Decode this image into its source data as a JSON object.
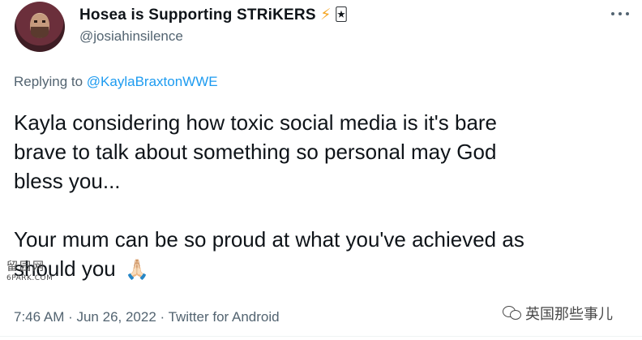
{
  "author": {
    "display_name": "Hosea is Supporting STRiKERS",
    "name_emoji_bolt": "⚡",
    "name_emoji_jester": "🃏",
    "handle": "@josiahinsilence"
  },
  "reply": {
    "prefix": "Replying to ",
    "mention": "@KaylaBraxtonWWE"
  },
  "body": {
    "line1": "Kayla considering how toxic social media is it's bare",
    "line2": "brave to talk about something so personal may God",
    "line3": "bless you...",
    "line4": "Your mum can be so proud at what you've achieved as",
    "line5": "should you",
    "emoji": "🙏🏻"
  },
  "meta": {
    "text": "7:46 AM · Jun 26, 2022 · Twitter for Android"
  },
  "watermarks": {
    "left_cjk": "留园网",
    "left_site": "6PARK.COM",
    "right_text": "英国那些事儿"
  },
  "colors": {
    "text": "#0f1419",
    "secondary": "#536471",
    "link": "#1d9bf0"
  },
  "icons": [
    "avatar-image",
    "more-options-icon",
    "wechat-icon"
  ]
}
